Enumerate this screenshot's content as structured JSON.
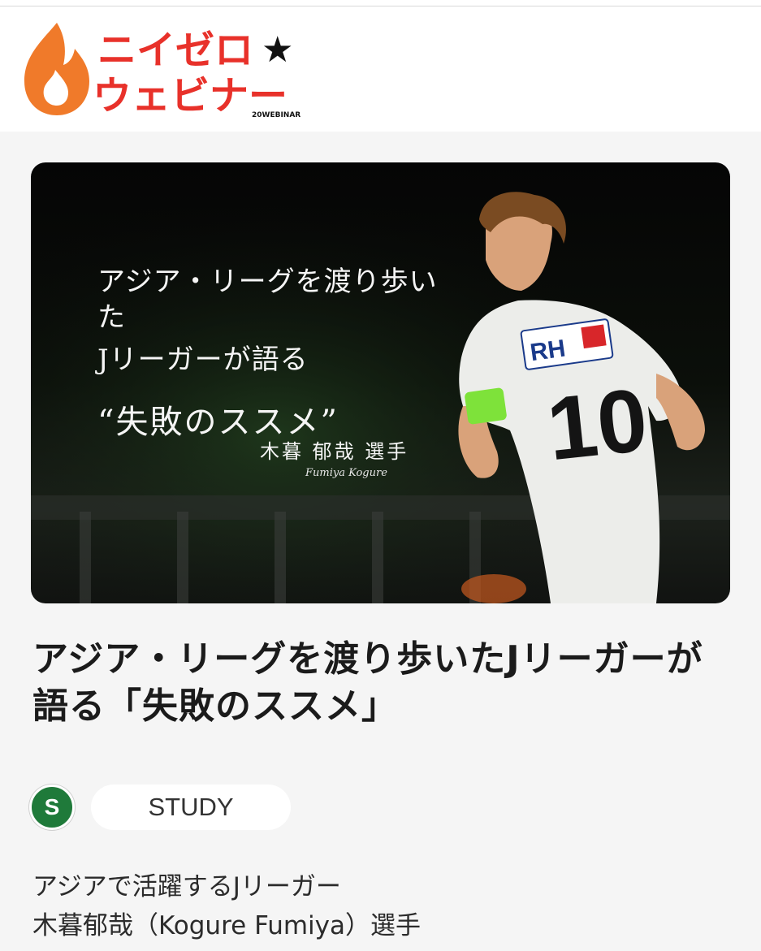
{
  "header": {
    "logo_line1": "ニイゼロ",
    "logo_star": "★",
    "logo_line2": "ウェビナー",
    "logo_sub": "20WEBINAR"
  },
  "hero": {
    "line1": "アジア・リーグを渡り歩いた",
    "line2": "Jリーガーが語る",
    "line3": "“失敗のススメ”",
    "name": "木暮 郁哉 選手",
    "signature": "Fumiya Kogure",
    "jersey_sponsor": "RH",
    "jersey_number": "10"
  },
  "article": {
    "title": "アジア・リーグを渡り歩いたJリーガーが語る「失敗のススメ」",
    "avatar_letter": "S",
    "category": "STUDY",
    "desc_line1": "アジアで活躍するJリーガー",
    "desc_line2": "木暮郁哉（Kogure Fumiya）選手"
  },
  "colors": {
    "brand_red": "#e8312a",
    "flame_orange": "#f07a2a",
    "avatar_green": "#1f7a3a",
    "captain_band": "#7ee23a"
  }
}
